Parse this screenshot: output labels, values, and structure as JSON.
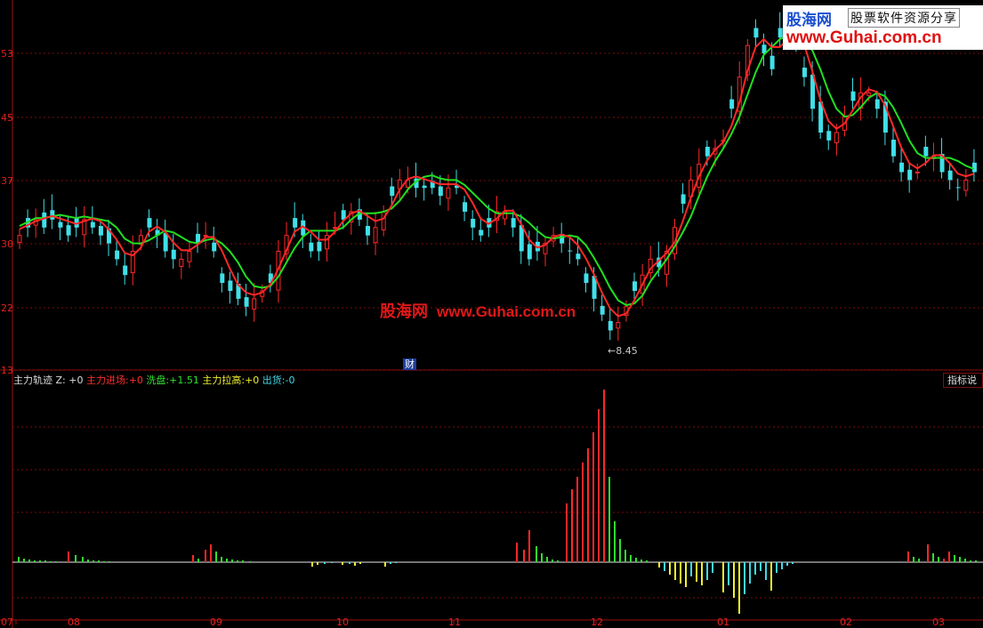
{
  "y_axis_labels": [
    "53",
    "45",
    "37",
    "30",
    "22",
    "13"
  ],
  "x_axis_labels": [
    "07",
    "08",
    "09",
    "10",
    "11",
    "12",
    "01",
    "02",
    "03"
  ],
  "low_marker": "8.45",
  "fin_badge": "财",
  "indicator": {
    "name": "主力轨迹",
    "z_label": "Z:",
    "z_value": "+0",
    "items": [
      {
        "label": "主力进场:",
        "value": "+0",
        "color": "#ff3030"
      },
      {
        "label": "洗盘:",
        "value": "+1.51",
        "color": "#30e030"
      },
      {
        "label": "主力拉高:",
        "value": "+0",
        "color": "#f0f030"
      },
      {
        "label": "出货:",
        "value": "-0",
        "color": "#40d8e8"
      }
    ],
    "button_label": "指标说"
  },
  "watermark": {
    "site_cn": "股海网",
    "site_url": "www.Guhai.com.cn"
  },
  "logo": {
    "name": "股海网",
    "slogan": "股票软件资源分享",
    "url": "www.Guhai.com.cn"
  },
  "colors": {
    "up": "#ff2828",
    "down": "#40e0e8",
    "ma_fast": "#ff2828",
    "ma_slow": "#20e020",
    "axis": "#a01010"
  },
  "chart_data": {
    "type": "candlestick",
    "y_ticks": [
      53,
      45,
      37,
      30,
      22,
      13
    ],
    "ylim": [
      13,
      58
    ],
    "months": [
      "07",
      "08",
      "09",
      "10",
      "11",
      "12",
      "01",
      "02",
      "03"
    ],
    "close_approx": [
      30,
      31,
      32,
      31,
      32,
      31,
      30,
      31,
      32,
      31,
      30,
      29,
      27,
      25,
      28,
      30,
      31,
      30,
      28,
      27,
      27,
      28,
      29,
      30,
      28,
      24,
      23,
      22,
      21,
      22,
      23,
      24,
      28,
      30,
      31,
      30,
      28,
      28,
      30,
      31,
      32,
      33,
      32,
      30,
      31,
      33,
      35,
      37,
      37,
      36,
      36,
      36,
      35,
      36,
      36,
      33,
      31,
      30,
      31,
      33,
      33,
      31,
      28,
      27,
      28,
      29,
      30,
      29,
      28,
      27,
      24,
      22,
      20,
      18,
      19,
      21,
      23,
      25,
      27,
      26,
      28,
      31,
      34,
      37,
      39,
      40,
      41,
      42,
      46,
      50,
      54,
      55,
      53,
      51,
      55,
      56,
      54,
      50,
      46,
      43,
      42,
      43,
      45,
      47,
      48,
      48,
      46,
      43,
      40,
      38,
      37,
      38,
      40,
      40,
      38,
      37,
      36,
      37,
      38
    ],
    "low": 8.45
  }
}
